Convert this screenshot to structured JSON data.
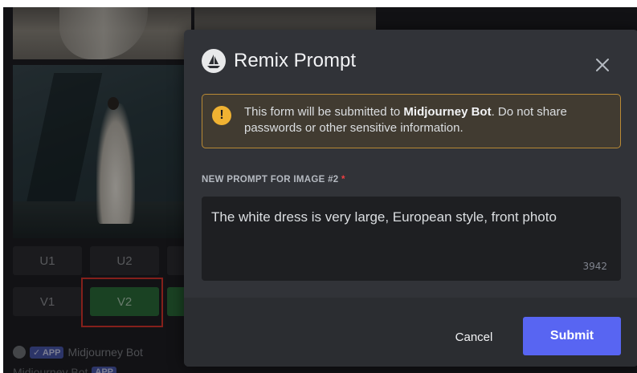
{
  "background_chat": {
    "upscale_buttons": [
      "U1",
      "U2"
    ],
    "variation_buttons": [
      "V1",
      "V2"
    ],
    "bot_name": "Midjourney Bot",
    "app_tag": "✓ APP",
    "bot_name_2": "Midjourney Bot",
    "app_tag_2": "APP"
  },
  "modal": {
    "title": "Remix Prompt",
    "close_icon": "close-icon",
    "warning": {
      "icon": "warning-icon",
      "text_before": "This form will be submitted to ",
      "bot_name": "Midjourney Bot",
      "text_after": ". Do not share passwords or other sensitive information."
    },
    "field_label": "NEW PROMPT FOR IMAGE #2",
    "required_marker": "*",
    "prompt_value": "The white dress is very large, European style, front photo",
    "char_count": "3942",
    "cancel_label": "Cancel",
    "submit_label": "Submit"
  },
  "colors": {
    "accent": "#5865f2",
    "warning": "#f0b232",
    "variation_selected": "#2a6b39",
    "highlight_border": "#d6352c"
  }
}
